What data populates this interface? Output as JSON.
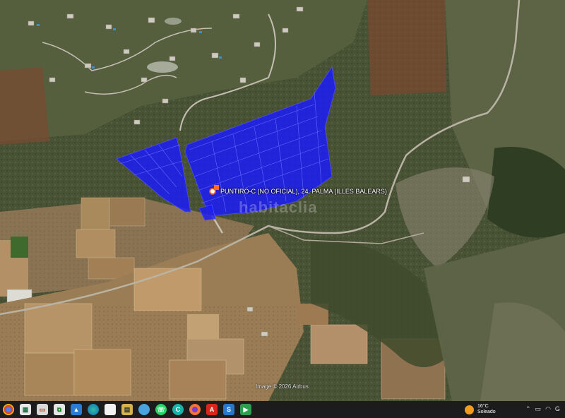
{
  "map": {
    "parcel_label": "PUNTIRO-C (NO OFICIAL), 24, PALMA (ILLES BALEARS)",
    "watermark": "habitaclia",
    "imagery_credit": "Image © 2026 Airbus",
    "parcel_color": "#1a1aff"
  },
  "taskbar": {
    "icons": [
      "chrome-icon",
      "spreadsheet-icon",
      "presentation-icon",
      "network-icon",
      "photos-icon",
      "edge-icon",
      "file-icon",
      "archive-icon",
      "globe-icon",
      "whatsapp-icon",
      "c-app-icon",
      "firefox-icon",
      "acrobat-icon",
      "s-app-icon",
      "play-icon"
    ],
    "weather_temp": "16°C",
    "weather_desc": "Soleado",
    "tray_text": "G"
  }
}
